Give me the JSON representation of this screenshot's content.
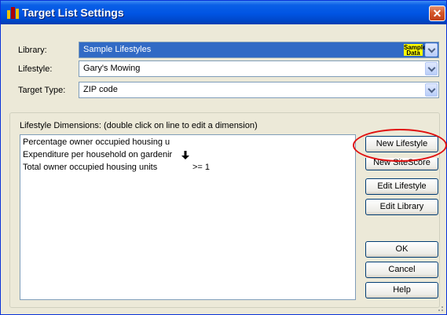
{
  "window": {
    "title": "Target List Settings",
    "close_label": "✕"
  },
  "fields": {
    "library_label": "Library:",
    "library_value": "Sample Lifestyles",
    "library_badge": "Sample Data",
    "lifestyle_label": "Lifestyle:",
    "lifestyle_value": "Gary's Mowing",
    "target_type_label": "Target Type:",
    "target_type_value": "ZIP code"
  },
  "dimensions": {
    "caption": "Lifestyle Dimensions: (double click on line to edit a dimension)",
    "rows": [
      {
        "name": "Percentage owner occupied housing u",
        "criterion": ""
      },
      {
        "name": "Expenditure per household on gardenir",
        "criterion": ""
      },
      {
        "name": "Total owner occupied housing units",
        "criterion": ">= 1"
      }
    ]
  },
  "buttons": {
    "new_lifestyle": "New Lifestyle",
    "new_sitescore": "New SiteScore",
    "edit_lifestyle": "Edit Lifestyle",
    "edit_library": "Edit Library",
    "ok": "OK",
    "cancel": "Cancel",
    "help": "Help"
  },
  "colors": {
    "titlebar": "#0054e3",
    "selection": "#316ac5",
    "badge": "#ffff00",
    "annotation": "#e01010"
  }
}
